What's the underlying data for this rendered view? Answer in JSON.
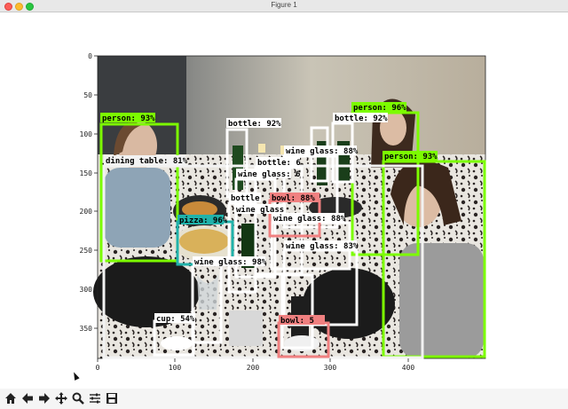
{
  "window": {
    "title": "Figure 1"
  },
  "axes": {
    "x_ticks": [
      "0",
      "100",
      "200",
      "300",
      "400"
    ],
    "y_ticks": [
      "0",
      "50",
      "100",
      "150",
      "200",
      "250",
      "300",
      "350"
    ]
  },
  "detections": [
    {
      "label": "person: 93%",
      "color": "#7cfc00"
    },
    {
      "label": "person: 96%",
      "color": "#7cfc00"
    },
    {
      "label": "person: 93%",
      "color": "#7cfc00"
    },
    {
      "label": "dining table: 81%",
      "color": "#f5f5f5"
    },
    {
      "label": "bottle: 92%",
      "color": "#ffffff"
    },
    {
      "label": "bottle: 92%",
      "color": "#ffffff"
    },
    {
      "label": "bottle: 6",
      "color": "#ffffff"
    },
    {
      "label": "bottle",
      "color": "#ffffff"
    },
    {
      "label": "wine glass: 88%",
      "color": "#ffffff"
    },
    {
      "label": "wine glass: 6",
      "color": "#ffffff"
    },
    {
      "label": "wine glass",
      "color": "#ffffff"
    },
    {
      "label": "wine glass: 88%",
      "color": "#ffffff"
    },
    {
      "label": "wine glass: 83%",
      "color": "#ffffff"
    },
    {
      "label": "wine glass: 98%",
      "color": "#ffffff"
    },
    {
      "label": "pizza: 96%",
      "color": "#20b2aa"
    },
    {
      "label": "bowl: 88%",
      "color": "#f08080"
    },
    {
      "label": "bowl: 5",
      "color": "#f08080"
    },
    {
      "label": "cup: 54%",
      "color": "#ffffff"
    }
  ],
  "toolbar": {
    "buttons": [
      "home-icon",
      "back-arrow-icon",
      "forward-arrow-icon",
      "pan-icon",
      "zoom-icon",
      "configure-subplots-icon",
      "save-icon"
    ]
  }
}
